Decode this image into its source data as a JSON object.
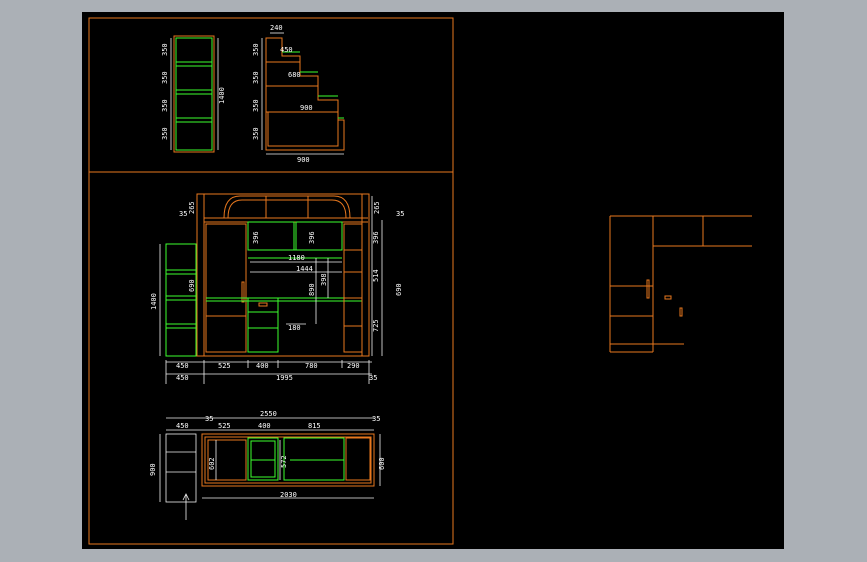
{
  "colors": {
    "background": "#000000",
    "outer_chrome": "#abb0b6",
    "frame": "#e8781e",
    "cabinet_green": "#3cff2e",
    "dimension_white": "#f0f0f0"
  },
  "top_views": {
    "left_column": [
      "350",
      "350",
      "350",
      "350"
    ],
    "left_total": "1400",
    "stair_column": [
      "350",
      "350",
      "350",
      "350"
    ],
    "stair_top": "240",
    "stair_widths": [
      "450",
      "680",
      "900"
    ],
    "stair_bottom": "900"
  },
  "elevation": {
    "top_dims": [
      "265",
      "35",
      "265",
      "35"
    ],
    "inner_vertical": [
      "396",
      "396",
      "396",
      "514",
      "725"
    ],
    "horizontal_inner": [
      "1180",
      "1444",
      "890",
      "180"
    ],
    "left_height": "1400",
    "left_mid": "690",
    "right_mid": "690",
    "mid_398": "398",
    "bottom_row": [
      "450",
      "525",
      "400",
      "780",
      "290"
    ],
    "bottom_total_row": [
      "450",
      "1995",
      "35"
    ]
  },
  "plan": {
    "top_total": "2550",
    "top_dims": [
      "35",
      "450",
      "525",
      "400",
      "815",
      "35"
    ],
    "side_left": "900",
    "side_inner_left": "602",
    "side_inner_mid": "572",
    "side_right": "600",
    "bottom_total": "2030"
  }
}
